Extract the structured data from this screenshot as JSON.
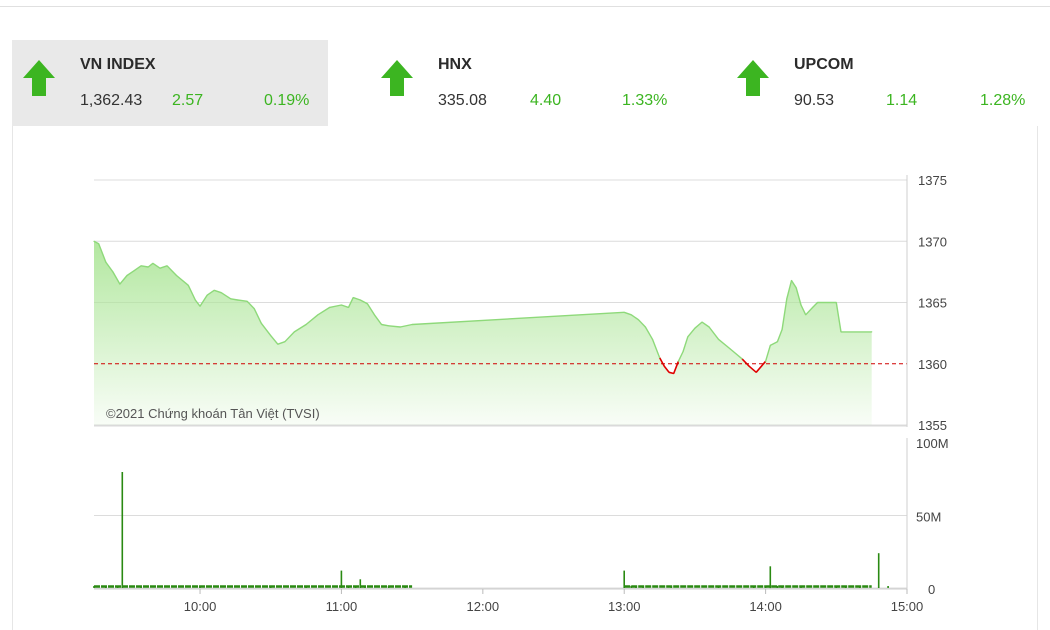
{
  "tabs": [
    {
      "name": "VN INDEX",
      "value": "1,362.43",
      "change": "2.57",
      "pct": "0.19%",
      "active": true
    },
    {
      "name": "HNX",
      "value": "335.08",
      "change": "4.40",
      "pct": "1.33%",
      "active": false
    },
    {
      "name": "UPCOM",
      "value": "90.53",
      "change": "1.14",
      "pct": "1.28%",
      "active": false
    }
  ],
  "colors": {
    "up": "#3cb521",
    "down": "#e00000",
    "area_fill": "#aee69a",
    "line": "#8ed97a",
    "ref": "#d00000",
    "volume": "#2a8a12"
  },
  "chart_data": {
    "type": "area",
    "watermark": "©2021 Chứng khoán Tân Việt (TVSI)",
    "price": {
      "ylim": [
        1355,
        1375
      ],
      "yticks": [
        "1375",
        "1370",
        "1365",
        "1360",
        "1355"
      ],
      "reference": 1360,
      "points": [
        [
          "09:15",
          1370.0
        ],
        [
          "09:17",
          1369.8
        ],
        [
          "09:20",
          1368.3
        ],
        [
          "09:23",
          1367.5
        ],
        [
          "09:26",
          1366.5
        ],
        [
          "09:29",
          1367.2
        ],
        [
          "09:32",
          1367.6
        ],
        [
          "09:35",
          1368.0
        ],
        [
          "09:38",
          1367.9
        ],
        [
          "09:40",
          1368.2
        ],
        [
          "09:43",
          1367.8
        ],
        [
          "09:46",
          1368.0
        ],
        [
          "09:50",
          1367.2
        ],
        [
          "09:55",
          1366.4
        ],
        [
          "09:58",
          1365.2
        ],
        [
          "10:00",
          1364.7
        ],
        [
          "10:03",
          1365.6
        ],
        [
          "10:06",
          1366.0
        ],
        [
          "10:09",
          1365.8
        ],
        [
          "10:13",
          1365.3
        ],
        [
          "10:16",
          1365.2
        ],
        [
          "10:20",
          1365.1
        ],
        [
          "10:23",
          1364.5
        ],
        [
          "10:26",
          1363.3
        ],
        [
          "10:30",
          1362.3
        ],
        [
          "10:33",
          1361.6
        ],
        [
          "10:36",
          1361.8
        ],
        [
          "10:40",
          1362.6
        ],
        [
          "10:45",
          1363.2
        ],
        [
          "10:50",
          1364.0
        ],
        [
          "10:55",
          1364.6
        ],
        [
          "11:00",
          1364.8
        ],
        [
          "11:03",
          1364.6
        ],
        [
          "11:05",
          1365.4
        ],
        [
          "11:08",
          1365.2
        ],
        [
          "11:11",
          1364.9
        ],
        [
          "11:14",
          1364.0
        ],
        [
          "11:17",
          1363.2
        ],
        [
          "11:20",
          1363.1
        ],
        [
          "11:25",
          1363.0
        ],
        [
          "11:30",
          1363.2
        ],
        [
          "13:00",
          1364.2
        ],
        [
          "13:03",
          1364.0
        ],
        [
          "13:06",
          1363.6
        ],
        [
          "13:09",
          1363.0
        ],
        [
          "13:12",
          1362.0
        ],
        [
          "13:15",
          1360.5
        ],
        [
          "13:17",
          1359.8
        ],
        [
          "13:19",
          1359.3
        ],
        [
          "13:21",
          1359.2
        ],
        [
          "13:23",
          1360.2
        ],
        [
          "13:25",
          1361.0
        ],
        [
          "13:27",
          1362.2
        ],
        [
          "13:30",
          1362.9
        ],
        [
          "13:33",
          1363.4
        ],
        [
          "13:36",
          1363.0
        ],
        [
          "13:40",
          1362.0
        ],
        [
          "13:45",
          1361.2
        ],
        [
          "13:50",
          1360.4
        ],
        [
          "13:53",
          1359.8
        ],
        [
          "13:56",
          1359.3
        ],
        [
          "14:00",
          1360.2
        ],
        [
          "14:02",
          1361.5
        ],
        [
          "14:05",
          1361.8
        ],
        [
          "14:07",
          1362.8
        ],
        [
          "14:09",
          1365.3
        ],
        [
          "14:11",
          1366.8
        ],
        [
          "14:13",
          1366.2
        ],
        [
          "14:15",
          1364.8
        ],
        [
          "14:17",
          1364.0
        ],
        [
          "14:20",
          1364.6
        ],
        [
          "14:22",
          1365.0
        ],
        [
          "14:30",
          1365.0
        ],
        [
          "14:32",
          1362.6
        ],
        [
          "14:45",
          1362.6
        ]
      ]
    },
    "volume": {
      "ylim": [
        0,
        100
      ],
      "yticks": [
        "100M",
        "50M",
        "0"
      ],
      "unit": "M",
      "bars": [
        [
          "09:15",
          0
        ],
        [
          "09:20",
          0
        ],
        [
          "09:25",
          0
        ],
        [
          "09:27",
          80
        ],
        [
          "09:35",
          0
        ],
        [
          "10:00",
          0
        ],
        [
          "10:30",
          0
        ],
        [
          "10:45",
          0
        ],
        [
          "11:00",
          12
        ],
        [
          "11:03",
          0
        ],
        [
          "11:06",
          0
        ],
        [
          "11:08",
          6
        ],
        [
          "11:10",
          0
        ],
        [
          "11:20",
          0
        ],
        [
          "11:27",
          0
        ],
        [
          "13:00",
          12
        ],
        [
          "13:03",
          0
        ],
        [
          "13:05",
          0
        ],
        [
          "13:08",
          0
        ],
        [
          "13:20",
          0
        ],
        [
          "13:40",
          0
        ],
        [
          "13:55",
          0
        ],
        [
          "14:00",
          0
        ],
        [
          "14:02",
          15
        ],
        [
          "14:05",
          0
        ],
        [
          "14:07",
          0
        ],
        [
          "14:15",
          0
        ],
        [
          "14:30",
          0
        ],
        [
          "14:34",
          0
        ],
        [
          "14:40",
          0
        ],
        [
          "14:48",
          24
        ],
        [
          "14:52",
          0
        ]
      ]
    },
    "xticks": [
      "10:00",
      "11:00",
      "12:00",
      "13:00",
      "14:00",
      "15:00"
    ]
  }
}
